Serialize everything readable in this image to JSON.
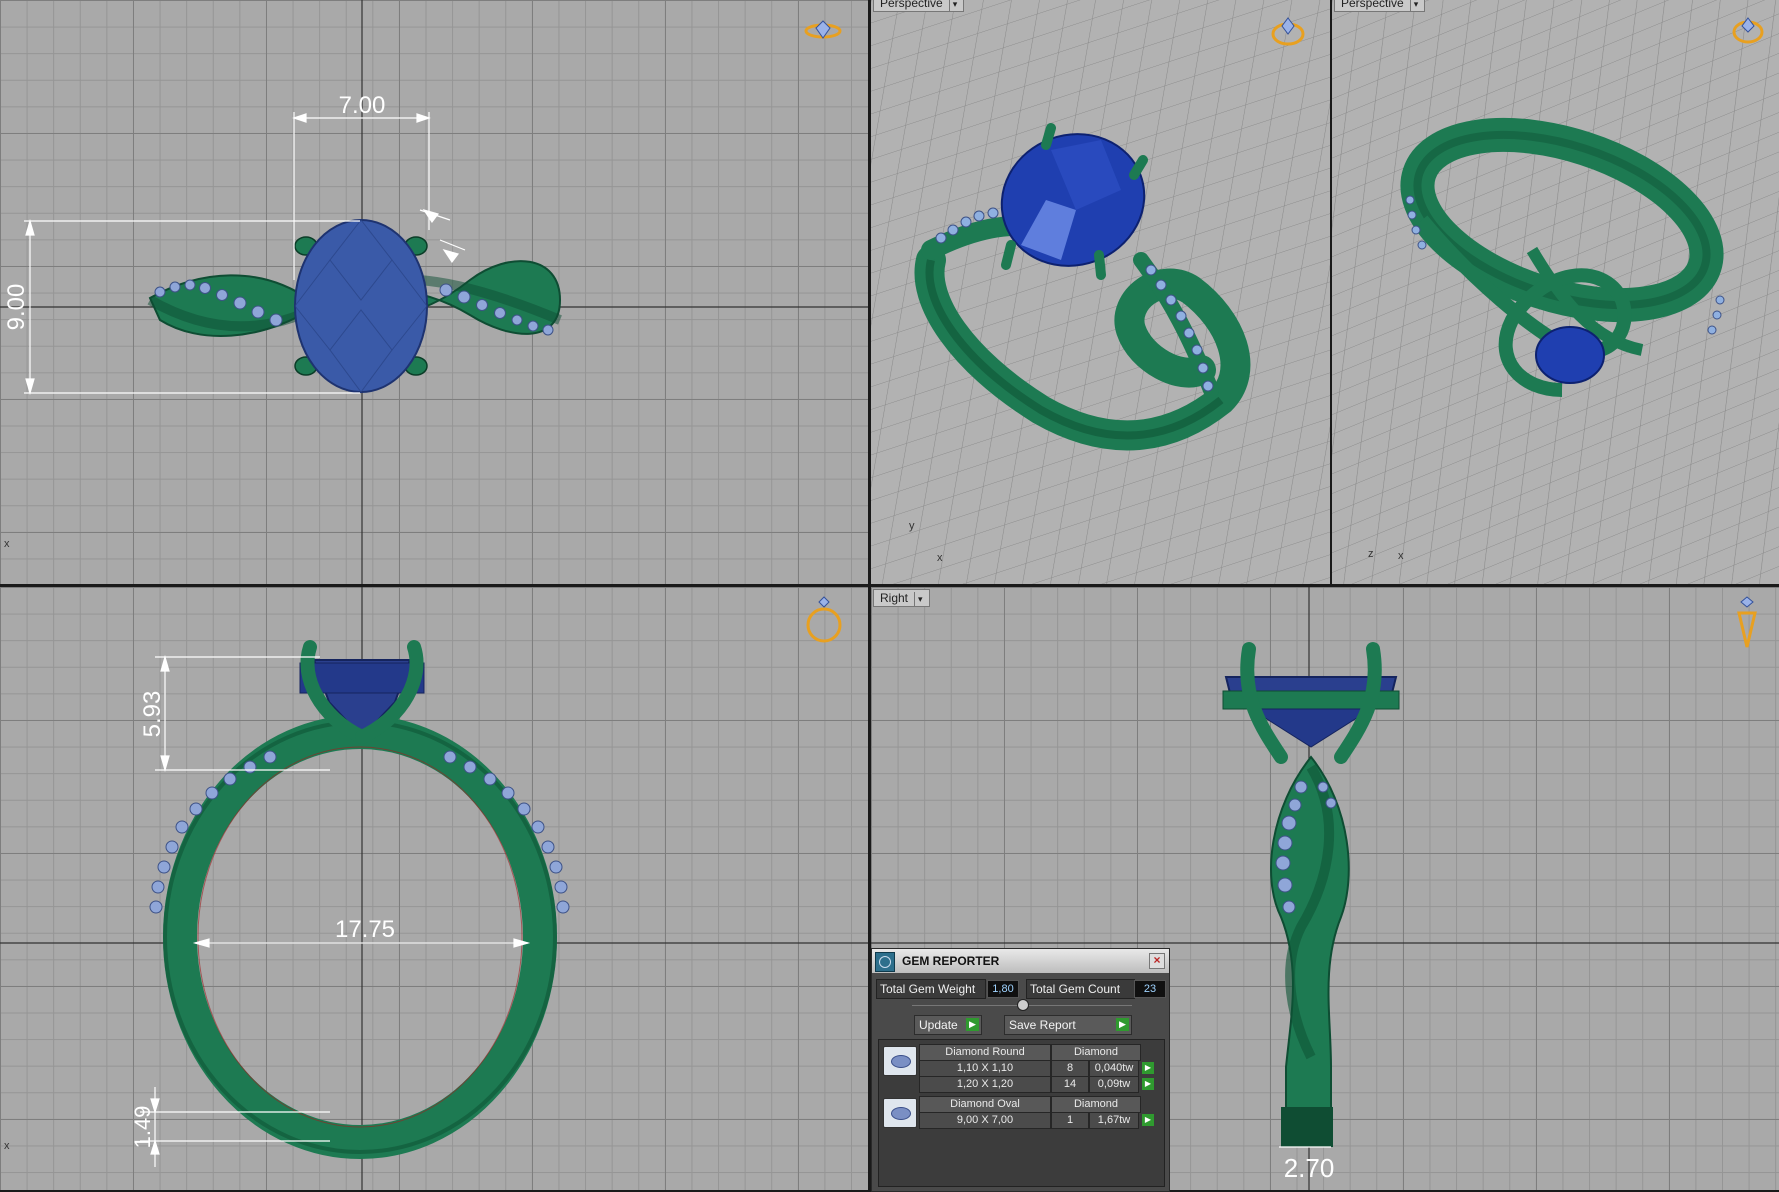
{
  "viewports": {
    "top": {
      "label": "",
      "axis": "x"
    },
    "perspective_1": {
      "label": "Perspective",
      "axis_x": "x",
      "axis_y": "y"
    },
    "perspective_2": {
      "label": "Perspective",
      "axis_x": "x",
      "axis_z": "z"
    },
    "front": {
      "label": "",
      "axis": "x"
    },
    "right": {
      "label": "Right"
    }
  },
  "dimensions": {
    "top_width": "7.00",
    "top_height": "9.00",
    "front_setting_height": "5.93",
    "front_inner_diameter": "17.75",
    "front_shank_thickness": "1.49",
    "right_shank_width": "2.70"
  },
  "colors": {
    "metal": "#1d7a52",
    "center_stone": "#2f4fa8",
    "accent_stone": "#8fa6d8",
    "nav_icon": "#e8a020",
    "viewport_bg": "#a9a9a9"
  },
  "gem_reporter": {
    "title": "GEM REPORTER",
    "close": "×",
    "total_weight_label": "Total Gem Weight",
    "total_weight_value": "1,80",
    "total_count_label": "Total Gem Count",
    "total_count_value": "23",
    "update_label": "Update",
    "save_label": "Save Report",
    "groups": [
      {
        "shape": "Diamond Round",
        "material": "Diamond",
        "rows": [
          {
            "size": "1,10 X 1,10",
            "count": "8",
            "weight": "0,040tw"
          },
          {
            "size": "1,20 X 1,20",
            "count": "14",
            "weight": "0,09tw"
          }
        ]
      },
      {
        "shape": "Diamond Oval",
        "material": "Diamond",
        "rows": [
          {
            "size": "9,00 X 7,00",
            "count": "1",
            "weight": "1,67tw"
          }
        ]
      }
    ]
  }
}
